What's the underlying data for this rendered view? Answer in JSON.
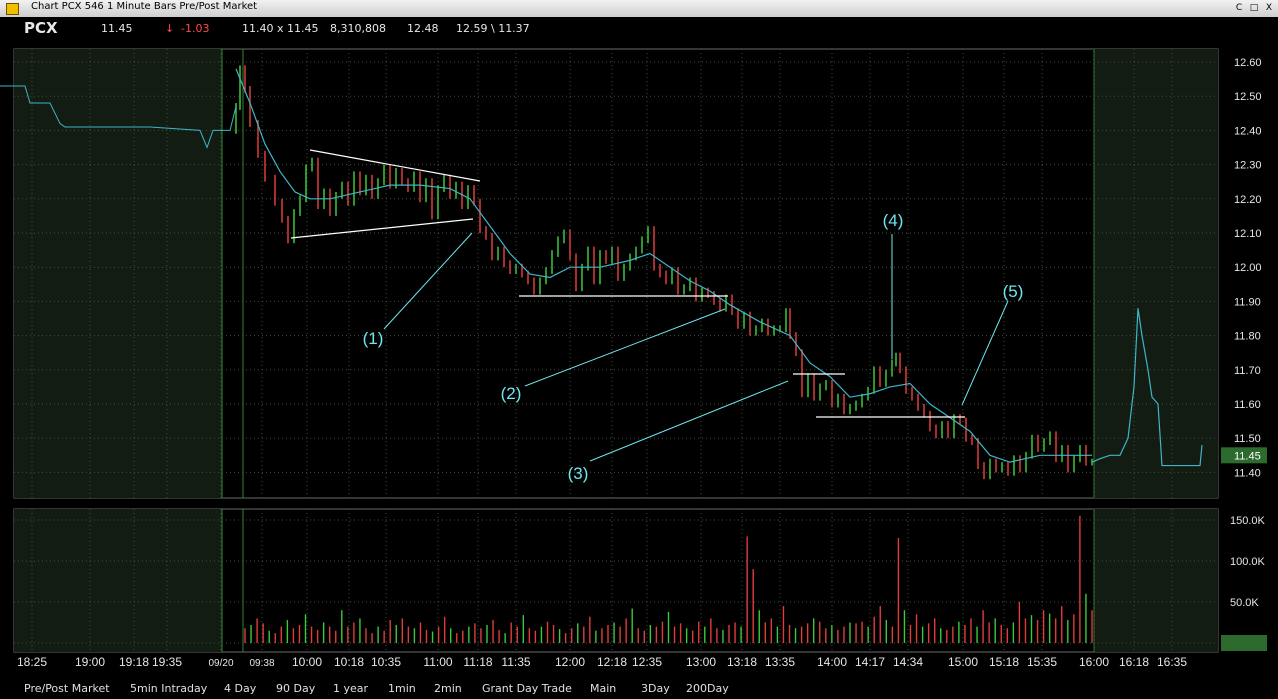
{
  "window": {
    "title": "Chart PCX 546 1 Minute Bars Pre/Post Market",
    "buttons": [
      "C",
      "□",
      "X"
    ]
  },
  "quote": {
    "symbol": "PCX",
    "last": "11.45",
    "arrow": "↓",
    "change": "-1.03",
    "bid_ask": "11.40 x 11.45",
    "volume": "8,310,808",
    "prev_close": "12.48",
    "high_low": "12.59 \\ 11.37"
  },
  "colors": {
    "up_bar": "#3cc83c",
    "down_bar": "#e03c3c",
    "ma_line": "#3fb5c8",
    "annotation": "#6fe6f0",
    "grid": "#3d4f3d",
    "prepost_bg": "#121c12",
    "current_price_box": "#2d6a2d"
  },
  "chart_data": {
    "type": "line",
    "description_series": "1-minute price bars with moving average, pre/post market shaded",
    "time_ticks": [
      "18:25",
      "19:00",
      "19:18",
      "19:35",
      "09/20",
      "09:38",
      "10:00",
      "10:18",
      "10:35",
      "11:00",
      "11:18",
      "11:35",
      "12:00",
      "12:18",
      "12:35",
      "13:00",
      "13:18",
      "13:35",
      "14:00",
      "14:17",
      "14:34",
      "15:00",
      "15:18",
      "15:35",
      "16:00",
      "16:18",
      "16:35"
    ],
    "price_ticks": [
      "12.60",
      "12.50",
      "12.40",
      "12.30",
      "12.20",
      "12.10",
      "12.00",
      "11.90",
      "11.80",
      "11.70",
      "11.60",
      "11.50",
      "11.40"
    ],
    "price_ylim": [
      11.35,
      12.65
    ],
    "volume_ticks": [
      "150.0K",
      "100.0K",
      "50.0K",
      "0"
    ],
    "volume_ylim": [
      0,
      160000
    ],
    "current_price_label": "11.45",
    "price_path": [
      [
        0,
        12.53
      ],
      [
        25,
        12.53
      ],
      [
        30,
        12.48
      ],
      [
        50,
        12.48
      ],
      [
        60,
        12.42
      ],
      [
        65,
        12.41
      ],
      [
        150,
        12.41
      ],
      [
        200,
        12.4
      ],
      [
        207,
        12.35
      ],
      [
        213,
        12.4
      ],
      [
        222,
        12.4
      ],
      [
        230,
        12.4
      ],
      [
        236,
        12.47
      ],
      [
        240,
        12.58
      ],
      [
        245,
        12.52
      ],
      [
        250,
        12.42
      ],
      [
        258,
        12.33
      ],
      [
        265,
        12.26
      ],
      [
        275,
        12.19
      ],
      [
        282,
        12.14
      ],
      [
        288,
        12.08
      ],
      [
        294,
        12.16
      ],
      [
        300,
        12.2
      ],
      [
        306,
        12.29
      ],
      [
        312,
        12.31
      ],
      [
        318,
        12.18
      ],
      [
        324,
        12.22
      ],
      [
        330,
        12.16
      ],
      [
        336,
        12.21
      ],
      [
        342,
        12.24
      ],
      [
        348,
        12.19
      ],
      [
        354,
        12.27
      ],
      [
        360,
        12.22
      ],
      [
        366,
        12.26
      ],
      [
        372,
        12.21
      ],
      [
        378,
        12.25
      ],
      [
        384,
        12.29
      ],
      [
        390,
        12.24
      ],
      [
        396,
        12.28
      ],
      [
        402,
        12.25
      ],
      [
        408,
        12.23
      ],
      [
        414,
        12.27
      ],
      [
        420,
        12.2
      ],
      [
        426,
        12.25
      ],
      [
        432,
        12.15
      ],
      [
        438,
        12.23
      ],
      [
        444,
        12.26
      ],
      [
        450,
        12.21
      ],
      [
        456,
        12.24
      ],
      [
        462,
        12.18
      ],
      [
        468,
        12.23
      ],
      [
        474,
        12.19
      ],
      [
        480,
        12.11
      ],
      [
        486,
        12.09
      ],
      [
        492,
        12.03
      ],
      [
        498,
        12.05
      ],
      [
        504,
        12.01
      ],
      [
        510,
        11.99
      ],
      [
        516,
        12.0
      ],
      [
        522,
        11.98
      ],
      [
        528,
        11.96
      ],
      [
        534,
        11.93
      ],
      [
        540,
        11.96
      ],
      [
        546,
        11.99
      ],
      [
        552,
        12.04
      ],
      [
        558,
        12.08
      ],
      [
        564,
        12.1
      ],
      [
        570,
        12.03
      ],
      [
        576,
        11.94
      ],
      [
        582,
        12.0
      ],
      [
        588,
        12.05
      ],
      [
        594,
        11.96
      ],
      [
        600,
        12.04
      ],
      [
        606,
        12.02
      ],
      [
        612,
        12.05
      ],
      [
        618,
        11.97
      ],
      [
        624,
        12.0
      ],
      [
        630,
        12.03
      ],
      [
        636,
        12.05
      ],
      [
        642,
        12.08
      ],
      [
        648,
        12.11
      ],
      [
        654,
        12.0
      ],
      [
        660,
        11.98
      ],
      [
        666,
        11.96
      ],
      [
        672,
        11.99
      ],
      [
        678,
        11.93
      ],
      [
        684,
        11.94
      ],
      [
        690,
        11.96
      ],
      [
        696,
        11.91
      ],
      [
        702,
        11.93
      ],
      [
        708,
        11.92
      ],
      [
        714,
        11.9
      ],
      [
        720,
        11.88
      ],
      [
        726,
        11.91
      ],
      [
        732,
        11.87
      ],
      [
        738,
        11.83
      ],
      [
        744,
        11.86
      ],
      [
        750,
        11.81
      ],
      [
        756,
        11.82
      ],
      [
        762,
        11.84
      ],
      [
        768,
        11.81
      ],
      [
        774,
        11.82
      ],
      [
        780,
        11.82
      ],
      [
        786,
        11.87
      ],
      [
        790,
        11.8
      ],
      [
        796,
        11.75
      ],
      [
        802,
        11.63
      ],
      [
        808,
        11.68
      ],
      [
        814,
        11.62
      ],
      [
        820,
        11.65
      ],
      [
        826,
        11.66
      ],
      [
        832,
        11.6
      ],
      [
        838,
        11.62
      ],
      [
        844,
        11.58
      ],
      [
        850,
        11.59
      ],
      [
        856,
        11.6
      ],
      [
        862,
        11.62
      ],
      [
        868,
        11.64
      ],
      [
        874,
        11.7
      ],
      [
        880,
        11.66
      ],
      [
        886,
        11.69
      ],
      [
        892,
        11.72
      ],
      [
        896,
        11.74
      ],
      [
        900,
        11.7
      ],
      [
        906,
        11.64
      ],
      [
        912,
        11.62
      ],
      [
        918,
        11.59
      ],
      [
        924,
        11.57
      ],
      [
        930,
        11.53
      ],
      [
        936,
        11.51
      ],
      [
        942,
        11.54
      ],
      [
        948,
        11.51
      ],
      [
        954,
        11.56
      ],
      [
        960,
        11.55
      ],
      [
        966,
        11.5
      ],
      [
        972,
        11.49
      ],
      [
        978,
        11.42
      ],
      [
        984,
        11.39
      ],
      [
        990,
        11.43
      ],
      [
        996,
        11.41
      ],
      [
        1002,
        11.42
      ],
      [
        1008,
        11.4
      ],
      [
        1014,
        11.44
      ],
      [
        1020,
        11.41
      ],
      [
        1026,
        11.45
      ],
      [
        1032,
        11.5
      ],
      [
        1038,
        11.47
      ],
      [
        1044,
        11.49
      ],
      [
        1050,
        11.51
      ],
      [
        1056,
        11.44
      ],
      [
        1062,
        11.47
      ],
      [
        1068,
        11.41
      ],
      [
        1074,
        11.44
      ],
      [
        1080,
        11.47
      ],
      [
        1086,
        11.43
      ],
      [
        1092,
        11.43
      ],
      [
        1100,
        11.44
      ],
      [
        1110,
        11.45
      ],
      [
        1120,
        11.45
      ],
      [
        1128,
        11.5
      ],
      [
        1134,
        11.65
      ],
      [
        1138,
        11.88
      ],
      [
        1142,
        11.8
      ],
      [
        1148,
        11.7
      ],
      [
        1152,
        11.62
      ],
      [
        1158,
        11.6
      ],
      [
        1162,
        11.42
      ],
      [
        1200,
        11.42
      ],
      [
        1202,
        11.48
      ]
    ],
    "ma_path": [
      [
        236,
        12.58
      ],
      [
        250,
        12.48
      ],
      [
        265,
        12.36
      ],
      [
        280,
        12.28
      ],
      [
        295,
        12.22
      ],
      [
        310,
        12.2
      ],
      [
        330,
        12.2
      ],
      [
        360,
        12.22
      ],
      [
        390,
        12.24
      ],
      [
        420,
        12.24
      ],
      [
        450,
        12.23
      ],
      [
        470,
        12.2
      ],
      [
        490,
        12.12
      ],
      [
        510,
        12.04
      ],
      [
        530,
        11.98
      ],
      [
        550,
        11.97
      ],
      [
        570,
        12.0
      ],
      [
        600,
        12.0
      ],
      [
        630,
        12.02
      ],
      [
        650,
        12.04
      ],
      [
        670,
        12.0
      ],
      [
        690,
        11.96
      ],
      [
        710,
        11.93
      ],
      [
        730,
        11.89
      ],
      [
        760,
        11.84
      ],
      [
        790,
        11.8
      ],
      [
        810,
        11.72
      ],
      [
        830,
        11.68
      ],
      [
        850,
        11.62
      ],
      [
        870,
        11.63
      ],
      [
        890,
        11.65
      ],
      [
        910,
        11.66
      ],
      [
        930,
        11.6
      ],
      [
        950,
        11.56
      ],
      [
        970,
        11.52
      ],
      [
        990,
        11.45
      ],
      [
        1010,
        11.43
      ],
      [
        1040,
        11.45
      ],
      [
        1070,
        11.45
      ],
      [
        1092,
        11.45
      ]
    ],
    "volume_values": [
      18000,
      22000,
      30000,
      24000,
      15000,
      12000,
      20000,
      28000,
      18000,
      22000,
      35000,
      20000,
      16000,
      25000,
      20000,
      15000,
      40000,
      20000,
      25000,
      30000,
      18000,
      12000,
      20000,
      15000,
      28000,
      22000,
      30000,
      20000,
      18000,
      25000,
      16000,
      14000,
      20000,
      32000,
      18000,
      12000,
      15000,
      20000,
      24000,
      18000,
      22000,
      28000,
      16000,
      12000,
      25000,
      20000,
      34000,
      18000,
      15000,
      20000,
      26000,
      22000,
      17000,
      12000,
      18000,
      24000,
      20000,
      32000,
      15000,
      18000,
      22000,
      25000,
      20000,
      30000,
      42000,
      18000,
      15000,
      22000,
      20000,
      26000,
      38000,
      20000,
      24000,
      18000,
      15000,
      26000,
      20000,
      30000,
      18000,
      16000,
      22000,
      25000,
      20000,
      130000,
      90000,
      40000,
      25000,
      30000,
      20000,
      45000,
      22000,
      18000,
      20000,
      24000,
      30000,
      26000,
      18000,
      22000,
      16000,
      20000,
      25000,
      24000,
      26000,
      20000,
      32000,
      45000,
      28000,
      20000,
      128000,
      40000,
      22000,
      35000,
      20000,
      24000,
      30000,
      18000,
      16000,
      20000,
      26000,
      22000,
      30000,
      20000,
      40000,
      25000,
      30000,
      22000,
      18000,
      25000,
      50000,
      30000,
      34000,
      28000,
      40000,
      36000,
      30000,
      45000,
      28000,
      35000,
      155000,
      60000,
      40000
    ],
    "annotations": [
      "(1)",
      "(2)",
      "(3)",
      "(4)",
      "(5)"
    ]
  },
  "tabs": [
    "Pre/Post Market",
    "5min Intraday",
    "4 Day",
    "90 Day",
    "1 year",
    "1min",
    "2min",
    "Grant Day Trade",
    "Main",
    "3Day",
    "200Day"
  ]
}
